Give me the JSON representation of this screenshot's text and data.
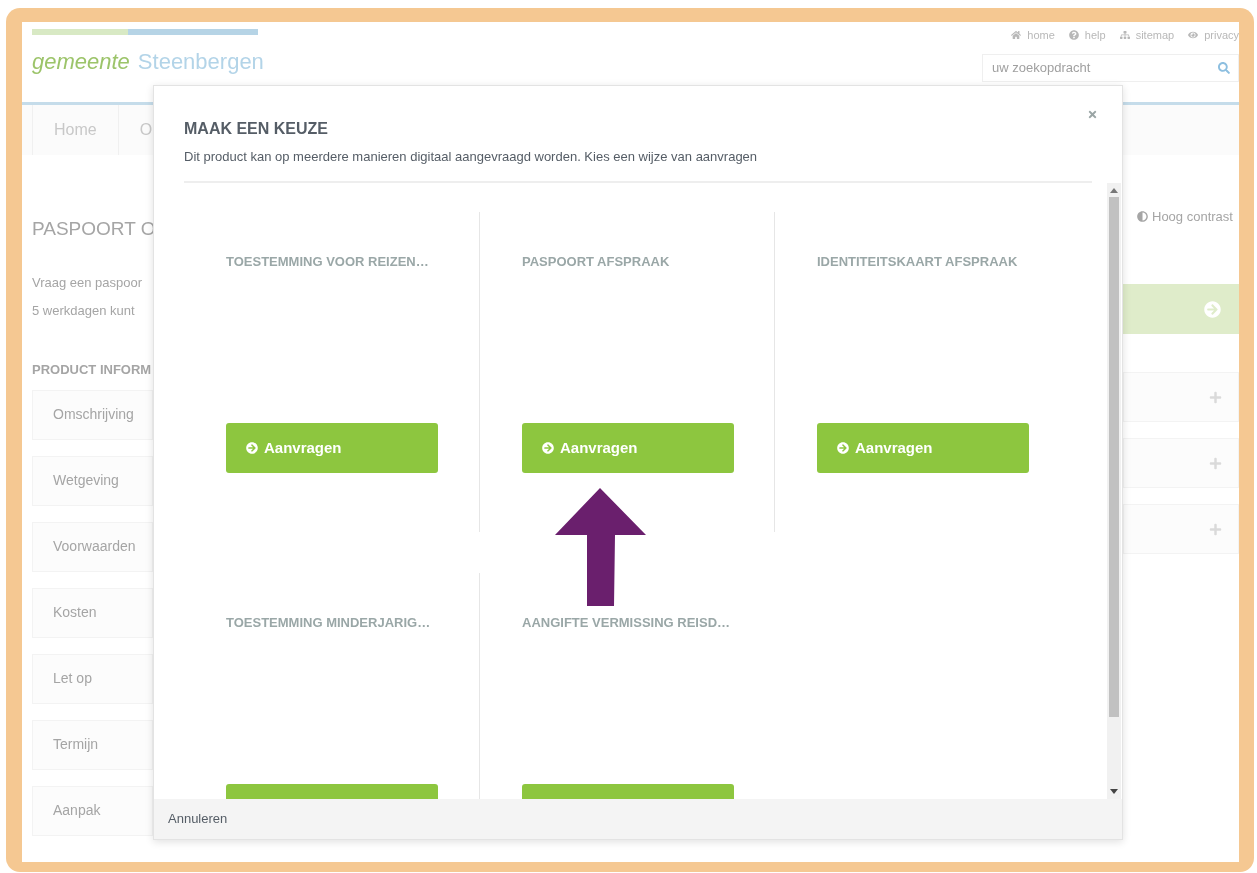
{
  "logo": {
    "word_1": "gemeente",
    "word_2": "Steenbergen"
  },
  "top_links": [
    {
      "label": "home",
      "kind": "home"
    },
    {
      "label": "help",
      "kind": "help"
    },
    {
      "label": "sitemap",
      "kind": "sitemap"
    },
    {
      "label": "privacy",
      "kind": "privacy"
    }
  ],
  "search": {
    "placeholder": "uw zoekopdracht"
  },
  "nav": [
    {
      "label": "Home"
    },
    {
      "label": "O"
    }
  ],
  "page": {
    "title": "PASPOORT O",
    "intro": [
      "Vraag een paspoor",
      "5 werkdagen kunt"
    ],
    "section_label": "PRODUCT INFORM",
    "accordion": [
      "Omschrijving",
      "Wetgeving",
      "Voorwaarden",
      "Kosten",
      "Let op",
      "Termijn",
      "Aanpak"
    ]
  },
  "sidebar": {
    "contrast": "Hoog contrast",
    "panels": [
      {
        "kind": "action"
      },
      {
        "kind": "expand"
      },
      {
        "kind": "expand"
      },
      {
        "kind": "expand"
      }
    ]
  },
  "modal": {
    "title": "MAAK EEN KEUZE",
    "subtitle": "Dit product kan op meerdere manieren digitaal aangevraagd worden. Kies een wijze van aanvragen",
    "options": [
      {
        "title": "TOESTEMMING VOOR REIZEN…",
        "button": "Aanvragen"
      },
      {
        "title": "PASPOORT AFSPRAAK",
        "button": "Aanvragen"
      },
      {
        "title": "IDENTITEITSKAART AFSPRAAK",
        "button": "Aanvragen"
      },
      {
        "title": "TOESTEMMING MINDERJARIG…"
      },
      {
        "title": "AANGIFTE VERMISSING REISD…"
      }
    ],
    "footer_button": "Annuleren"
  }
}
